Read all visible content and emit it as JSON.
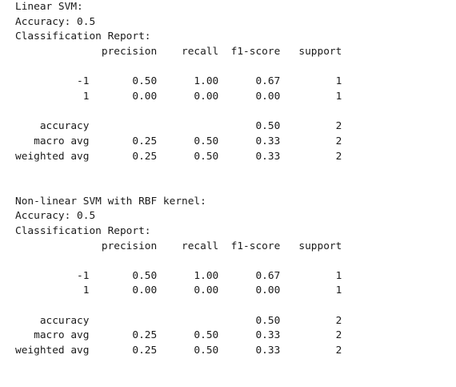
{
  "output_lines": [
    "Linear SVM:",
    "Accuracy: 0.5",
    "Classification Report:",
    "              precision    recall  f1-score   support",
    "",
    "          -1       0.50      1.00      0.67         1",
    "           1       0.00      0.00      0.00         1",
    "",
    "    accuracy                           0.50         2",
    "   macro avg       0.25      0.50      0.33         2",
    "weighted avg       0.25      0.50      0.33         2",
    "",
    "",
    "Non-linear SVM with RBF kernel:",
    "Accuracy: 0.5",
    "Classification Report:",
    "              precision    recall  f1-score   support",
    "",
    "          -1       0.50      1.00      0.67         1",
    "           1       0.00      0.00      0.00         1",
    "",
    "    accuracy                           0.50         2",
    "   macro avg       0.25      0.50      0.33         2",
    "weighted avg       0.25      0.50      0.33         2"
  ]
}
